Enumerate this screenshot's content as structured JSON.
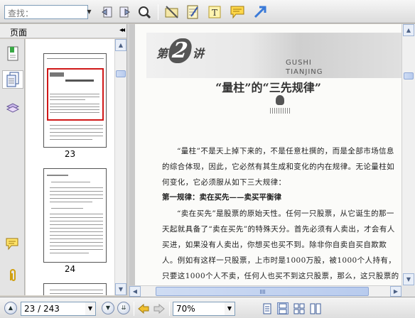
{
  "toolbar": {
    "search_placeholder": "查找：",
    "buttons": [
      "find-previous-icon",
      "find-next-icon",
      "find-options-icon",
      "select-tool-icon",
      "note-tool-icon",
      "text-tool-icon",
      "comment-tool-icon",
      "arrow-tool-icon"
    ]
  },
  "panel": {
    "title": "页面",
    "collapse": "◂◂",
    "thumbnails": [
      {
        "label": "23",
        "selected": true
      },
      {
        "label": "24",
        "selected": false
      }
    ]
  },
  "document": {
    "chapter_prefix": "第",
    "chapter_number": "2",
    "chapter_suffix": "讲",
    "banner_line1": "GUSHI",
    "banner_line2": "TIANJING",
    "title": "“量柱”的“三先规律”",
    "paragraphs": [
      "“量柱”不是天上掉下来的，不是任意杜撰的，而是全部市场信息的综合体现，因此，它必然有其生成和变化的内在规律。无论量柱如何变化，它必须服从如下三大规律：",
      "“卖在买先”是股票的原始天性。任何一只股票，从它诞生的那一天起就具备了“卖在买先”的特殊天分。首先必须有人卖出，才会有人买进，如果没有人卖出，你想买也买不到。除非你自卖自买自欺欺人。例如有这样一只股票，上市时是1000万股，被1000个人持有，只要这1000个人不卖，任何人也买不到这只股票，那么，这只股票的成交量必然是零。正是从这种意义上讲，任何量柱都是“卖出来的”，无卖必然无买，无卖"
    ],
    "section_heading": "第一规律：卖在买先——卖买平衡律"
  },
  "statusbar": {
    "page_value": "23 / 243",
    "zoom_value": "70%"
  }
}
